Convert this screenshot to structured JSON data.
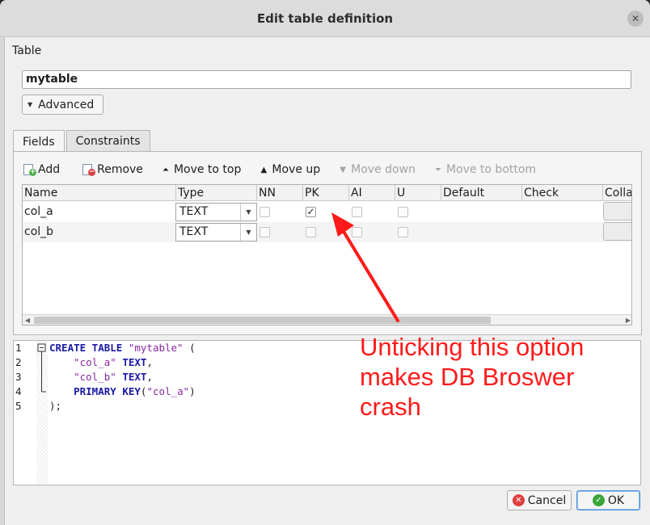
{
  "window": {
    "title": "Edit table definition"
  },
  "table": {
    "label": "Table",
    "name": "mytable",
    "advanced_label": "Advanced"
  },
  "tabs": [
    {
      "label": "Fields"
    },
    {
      "label": "Constraints"
    }
  ],
  "toolbar": {
    "add": "Add",
    "remove": "Remove",
    "move_top": "Move to top",
    "move_up": "Move up",
    "move_down": "Move down",
    "move_bottom": "Move to bottom"
  },
  "columns": [
    "Name",
    "Type",
    "NN",
    "PK",
    "AI",
    "U",
    "Default",
    "Check",
    "Colla"
  ],
  "fields": [
    {
      "name": "col_a",
      "type": "TEXT",
      "nn": false,
      "pk": true,
      "ai": false,
      "u": false
    },
    {
      "name": "col_b",
      "type": "TEXT",
      "nn": false,
      "pk": false,
      "ai": false,
      "u": false
    }
  ],
  "sql": {
    "line_numbers": [
      "1",
      "2",
      "3",
      "4",
      "5"
    ],
    "l1_kw": "CREATE TABLE",
    "l1_str": "\"mytable\"",
    "l1_end": " (",
    "l2_str": "\"col_a\"",
    "l2_kw": "TEXT",
    "l2_end": ",",
    "l3_str": "\"col_b\"",
    "l3_kw": "TEXT",
    "l3_end": ",",
    "l4_kw": "PRIMARY KEY",
    "l4_open": "(",
    "l4_str": "\"col_a\"",
    "l4_close": ")",
    "l5": ");"
  },
  "annotation": {
    "text": "Unticking this option makes DB Broswer crash",
    "color": "#ff1a1a"
  },
  "buttons": {
    "cancel": "Cancel",
    "ok": "OK"
  },
  "colors": {
    "cancel_icon": "#e04040",
    "ok_icon": "#3aa63a",
    "accent": "#4a90d9"
  }
}
